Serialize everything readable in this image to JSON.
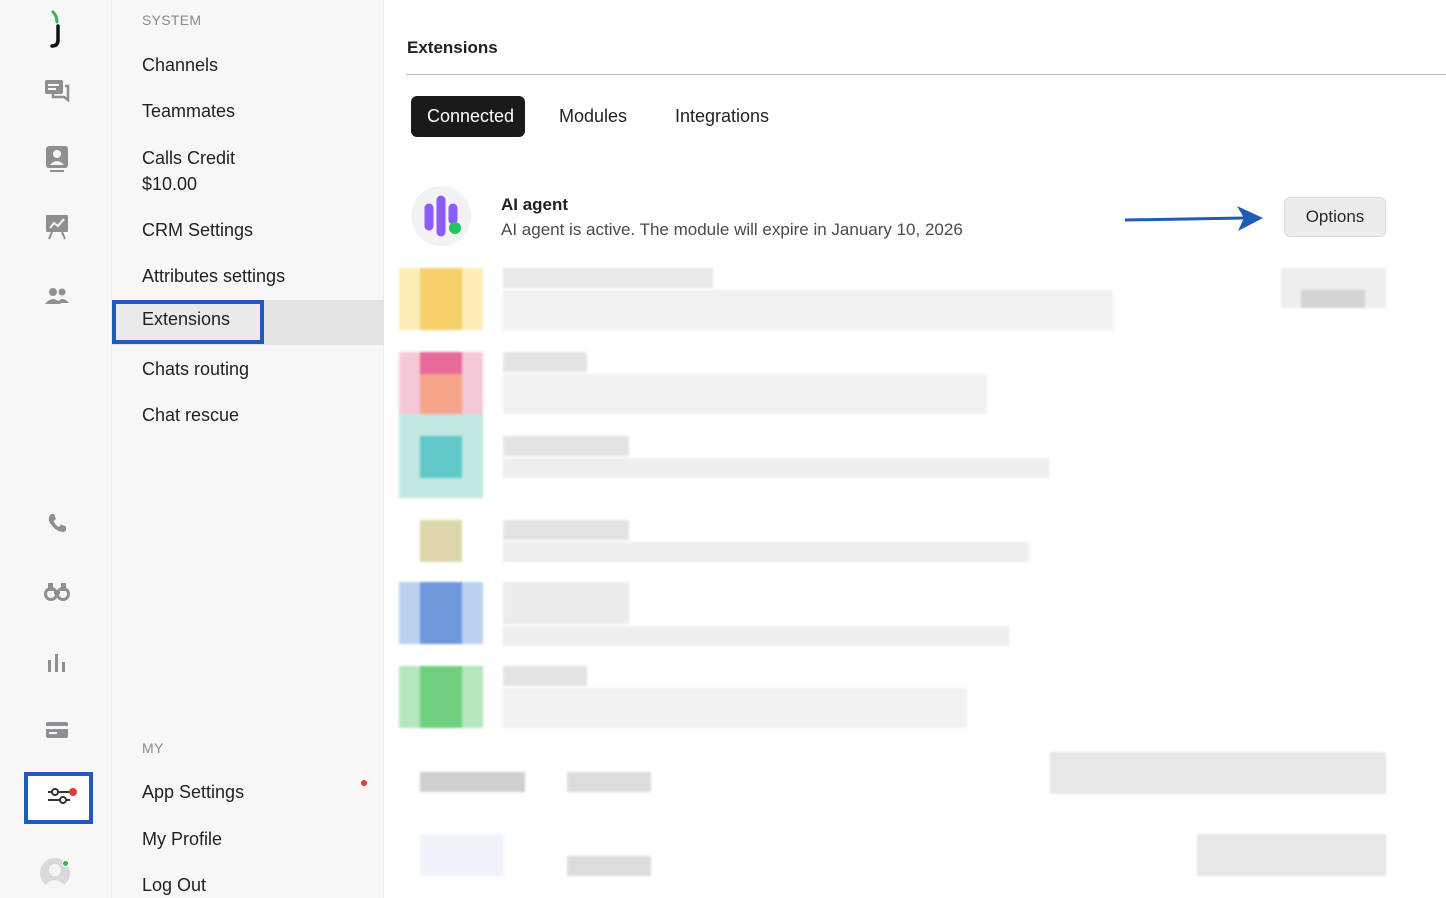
{
  "rail": {
    "icons": [
      {
        "name": "logo-icon"
      },
      {
        "name": "chats-icon"
      },
      {
        "name": "contacts-icon"
      },
      {
        "name": "analytics-board-icon"
      },
      {
        "name": "team-icon"
      },
      {
        "name": "phone-icon"
      },
      {
        "name": "binoculars-icon"
      },
      {
        "name": "bar-chart-icon"
      },
      {
        "name": "billing-card-icon"
      },
      {
        "name": "settings-sliders-icon"
      },
      {
        "name": "user-avatar-icon"
      }
    ]
  },
  "menu": {
    "system_label": "SYSTEM",
    "items": [
      {
        "label": "Channels"
      },
      {
        "label": "Teammates"
      },
      {
        "label": "Calls Credit"
      },
      {
        "label": "CRM Settings"
      },
      {
        "label": "Attributes settings"
      },
      {
        "label": "Extensions"
      },
      {
        "label": "Chats routing"
      },
      {
        "label": "Chat rescue"
      }
    ],
    "calls_credit_value": "$10.00",
    "my_label": "MY",
    "my_items": [
      {
        "label": "App Settings"
      },
      {
        "label": "My Profile"
      },
      {
        "label": "Log Out"
      }
    ]
  },
  "main": {
    "title": "Extensions",
    "tabs": [
      {
        "label": "Connected",
        "active": true
      },
      {
        "label": "Modules",
        "active": false
      },
      {
        "label": "Integrations",
        "active": false
      }
    ],
    "extension": {
      "name": "AI agent",
      "description": "AI agent is active. The module will expire in January 10, 2026",
      "options_label": "Options"
    }
  },
  "colors": {
    "accent_highlight": "#1f5bb8",
    "active_tab_bg": "#1a1a1a",
    "notification_dot": "#e5383b",
    "online_dot": "#2fb84f",
    "ai_logo_purple": "#8b5cf6",
    "ai_logo_green": "#22c55e"
  }
}
